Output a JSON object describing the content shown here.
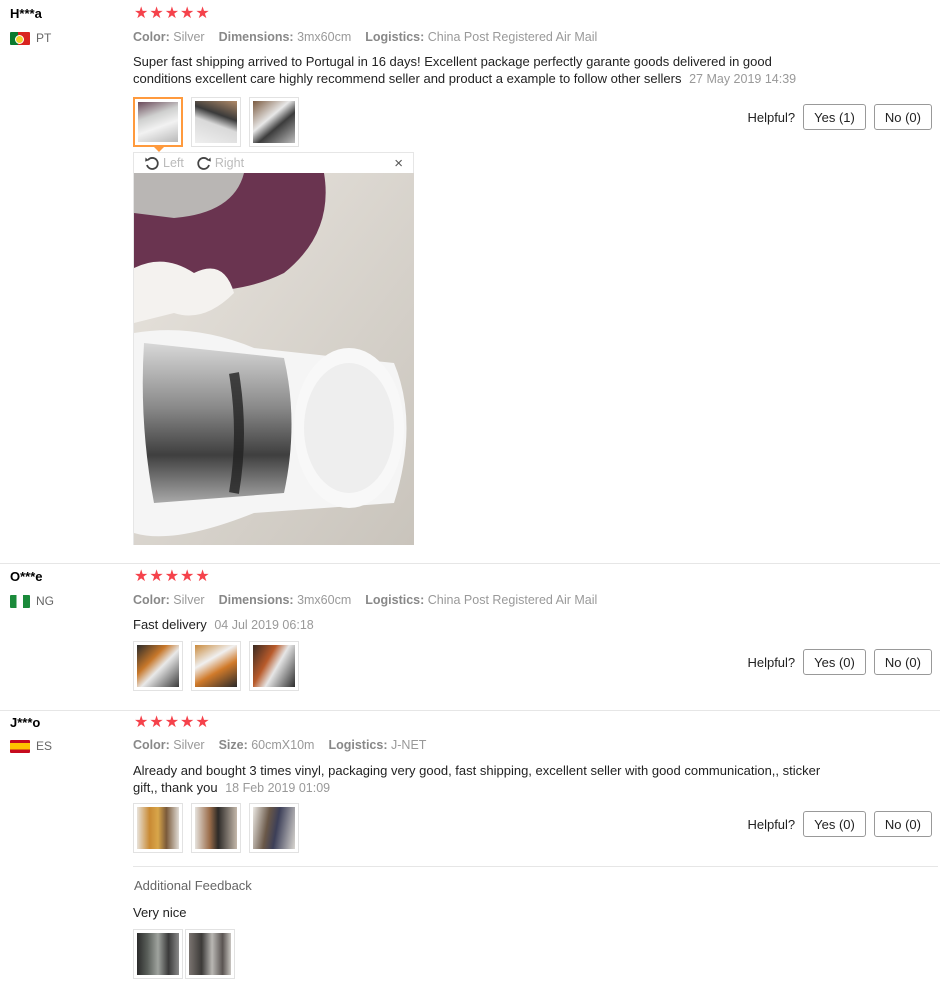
{
  "labels": {
    "helpful": "Helpful?",
    "additional_feedback": "Additional Feedback",
    "viewer_left": "Left",
    "viewer_right": "Right",
    "viewer_close": "×"
  },
  "reviews": [
    {
      "user": "H***a",
      "country": "PT",
      "rating": 5,
      "attrs": [
        {
          "key": "Color:",
          "value": "Silver"
        },
        {
          "key": "Dimensions:",
          "value": "3mx60cm"
        },
        {
          "key": "Logistics:",
          "value": "China Post Registered Air Mail"
        }
      ],
      "text": "Super fast shipping arrived to Portugal in 16 days! Excellent package perfectly garante goods delivered in good conditions excellent care highly recommend seller and product a example to follow other sellers",
      "date": "27 May 2019 14:39",
      "yes": "Yes (1)",
      "no": "No (0)"
    },
    {
      "user": "O***e",
      "country": "NG",
      "rating": 5,
      "attrs": [
        {
          "key": "Color:",
          "value": "Silver"
        },
        {
          "key": "Dimensions:",
          "value": "3mx60cm"
        },
        {
          "key": "Logistics:",
          "value": "China Post Registered Air Mail"
        }
      ],
      "text": "Fast delivery",
      "date": "04 Jul 2019 06:18",
      "yes": "Yes (0)",
      "no": "No (0)"
    },
    {
      "user": "J***o",
      "country": "ES",
      "rating": 5,
      "attrs": [
        {
          "key": "Color:",
          "value": "Silver"
        },
        {
          "key": "Size:",
          "value": "60cmX10m"
        },
        {
          "key": "Logistics:",
          "value": "J-NET"
        }
      ],
      "text": "Already and bought 3 times vinyl, packaging very good, fast shipping, excellent seller with good communication,, sticker gift,, thank you",
      "date": "18 Feb 2019 01:09",
      "yes": "Yes (0)",
      "no": "No (0)",
      "additional_text": "Very nice"
    }
  ]
}
